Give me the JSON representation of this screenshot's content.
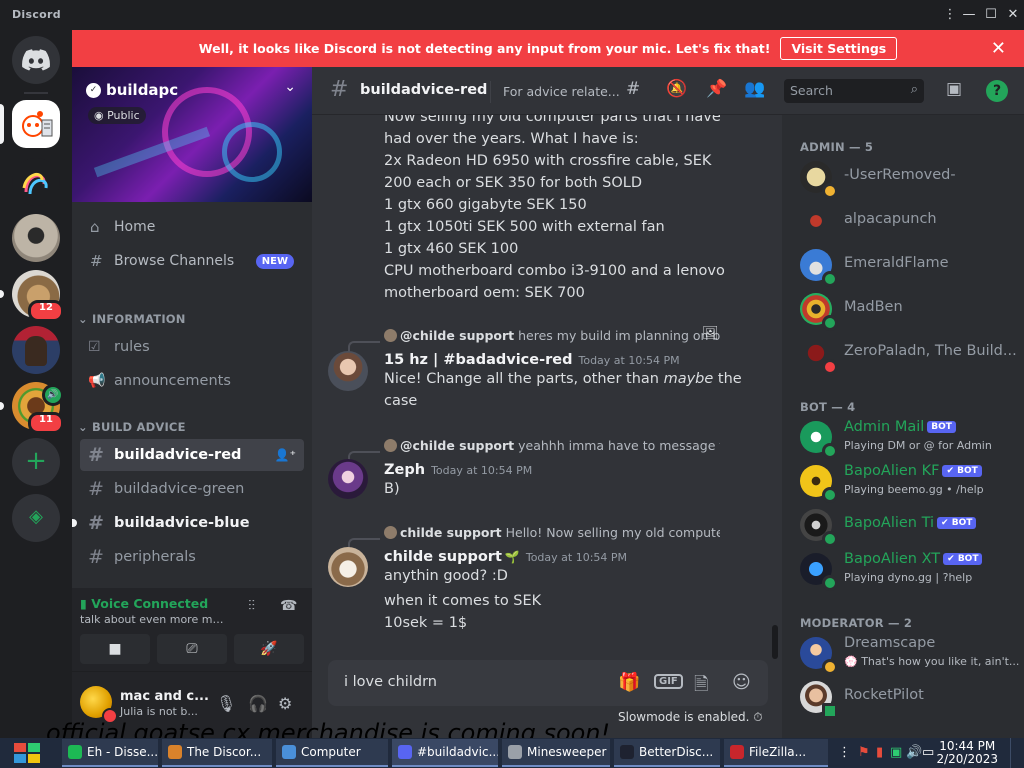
{
  "window": {
    "brand": "Discord",
    "min": "—",
    "max": "☐",
    "close": "✕"
  },
  "banner": {
    "message": "Well, it looks like Discord is not detecting any input from your mic. Let's fix that!",
    "button": "Visit Settings",
    "close": "✕"
  },
  "rail": {
    "badges": [
      "12",
      "11"
    ]
  },
  "guild": {
    "name": "buildapc",
    "visibility": "Public",
    "nav": [
      {
        "icon": "home-icon",
        "label": "Home"
      },
      {
        "icon": "browse-icon",
        "label": "Browse Channels",
        "badge": "NEW"
      }
    ],
    "categories": [
      {
        "name": "INFORMATION",
        "channels": [
          {
            "name": "rules"
          },
          {
            "name": "announcements"
          }
        ]
      },
      {
        "name": "BUILD ADVICE",
        "channels": [
          {
            "name": "buildadvice-red",
            "state": "active"
          },
          {
            "name": "buildadvice-green"
          },
          {
            "name": "buildadvice-blue",
            "state": "unread"
          },
          {
            "name": "peripherals"
          }
        ]
      }
    ]
  },
  "voice": {
    "status": "Voice Connected",
    "subtitle": "talk about even more mac a..."
  },
  "user": {
    "name": "mac and c...",
    "status": "Julia is not b..."
  },
  "channel_header": {
    "name": "buildadvice-red",
    "topic": "For advice relate...",
    "search_placeholder": "Search",
    "help": "?"
  },
  "messages": {
    "continued_lines": [
      "Now selling my old computer parts that I have",
      "had over the years. What I have is:",
      "2x Radeon HD 6950 with crossfire cable, SEK",
      "200 each or SEK 350 for both SOLD",
      "1 gtx 660 gigabyte SEK 150",
      "1 gtx 1050ti SEK 500 with external fan",
      "1 gtx 460 SEK 100",
      "CPU motherboard combo i3-9100 and a lenovo",
      "motherboard oem: SEK 700"
    ],
    "items": [
      {
        "reply_author": "@childe support",
        "reply_text": "heres my build im planning on b",
        "author": "15 hz | #badadvice-red",
        "time": "Today at 10:54 PM",
        "text_before": "Nice! Change all the parts, other than ",
        "text_em": "maybe",
        "text_after": " the",
        "text_line2": "case"
      },
      {
        "reply_author": "@childe support",
        "reply_text": "yeahhh imma have to message them",
        "author": "Zeph",
        "time": "Today at 10:54 PM",
        "text": "B)"
      },
      {
        "reply_author": "childe support",
        "reply_text": "Hello! Now selling my old computer pa",
        "author": "childe support",
        "time": "Today at 10:54 PM",
        "text": "anythin good? :D",
        "followups": [
          "when it comes to SEK",
          "10sek = 1$"
        ]
      }
    ]
  },
  "composer": {
    "value": "i love childrn",
    "gif": "GIF",
    "slowmode": "Slowmode is enabled."
  },
  "members": {
    "groups": [
      {
        "title": "ADMIN — 5",
        "members": [
          {
            "name": "-UserRemoved-",
            "status": "idle"
          },
          {
            "name": "alpacapunch",
            "status": "none"
          },
          {
            "name": "EmeraldFlame",
            "status": "online"
          },
          {
            "name": "MadBen",
            "status": "online"
          },
          {
            "name": "ZeroPaladn, The Build...",
            "status": "dnd"
          }
        ]
      },
      {
        "title": "BOT — 4",
        "members": [
          {
            "name": "Admin Mail",
            "tag": "BOT",
            "activity": "Playing DM or @ for Admin",
            "status": "online",
            "color": "#23a55a"
          },
          {
            "name": "BapoAlien KF",
            "tag": "✔ BOT",
            "activity": "Playing beemo.gg • /help",
            "status": "online",
            "color": "#23a55a"
          },
          {
            "name": "BapoAlien Ti",
            "tag": "✔ BOT",
            "activity": "",
            "status": "online",
            "color": "#23a55a"
          },
          {
            "name": "BapoAlien XT",
            "tag": "✔ BOT",
            "activity": "Playing dyno.gg | ?help",
            "status": "online",
            "color": "#23a55a"
          }
        ]
      },
      {
        "title": "MODERATOR — 2",
        "members": [
          {
            "name": "Dreamscape",
            "activity": "💮 That's how you like it, ain't...",
            "status": "idle"
          },
          {
            "name": "RocketPilot",
            "status": "mobile"
          }
        ]
      }
    ]
  },
  "desktop_overlay_text": "official goatse cx merchandise is coming soon!",
  "taskbar": {
    "tasks": [
      {
        "label": "Eh - Disse...",
        "icon_color": "#1db954"
      },
      {
        "label": "The Discor...",
        "icon_color": "#d9822b"
      },
      {
        "label": "Computer",
        "icon_color": "#4a8fd8"
      },
      {
        "label": "#buildadvic...",
        "icon_color": "#5865f2"
      },
      {
        "label": "Minesweeper",
        "icon_color": "#9aa0a8"
      },
      {
        "label": "BetterDisc...",
        "icon_color": "#1e2230"
      },
      {
        "label": "FileZilla...",
        "icon_color": "#c8262c"
      }
    ],
    "time": "10:44 PM",
    "date": "2/20/2023"
  },
  "colors": {
    "accent": "#5865f2",
    "online": "#23a55a",
    "danger": "#f23f43",
    "idle": "#f0b232"
  }
}
